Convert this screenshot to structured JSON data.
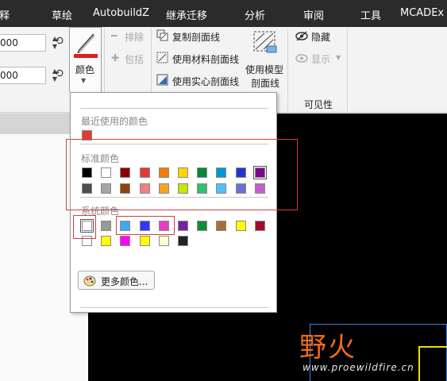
{
  "menu": {
    "items": [
      "注释",
      "草绘",
      "AutobuildZ",
      "继承迁移",
      "分析",
      "审阅",
      "工具",
      "MCADEx"
    ]
  },
  "ribbon": {
    "field1_value": "000",
    "field2_value": "000",
    "color_label": "颜色",
    "exclude_label": "排除",
    "include_label": "包括",
    "copy_hatch_label": "复制剖面线",
    "use_material_hatch_label": "使用材料剖面线",
    "use_solid_hatch_label": "使用实心剖面线",
    "use_model_hatch_label_line1": "使用模型",
    "use_model_hatch_label_line2": "剖面线",
    "hide_label": "隐藏",
    "show_label": "显示",
    "visibility_group_label": "可见性",
    "accent_red": "#e02020"
  },
  "dropdown": {
    "recent_title": "最近使用的颜色",
    "recent_colors": [
      "#e53935"
    ],
    "standard_title": "标准颜色",
    "standard_row1": [
      "#000000",
      "#ffffff",
      "#8b0000",
      "#e53935",
      "#f57c00",
      "#ffd600",
      "#00893a",
      "#0097d6",
      "#2433d6",
      "#7a0a8c"
    ],
    "standard_row2": [
      "#4d4d4d",
      "#a6a6a6",
      "#8b4513",
      "#f08080",
      "#f5a623",
      "#c6e800",
      "#2ec26a",
      "#4fc3f7",
      "#6a6fd8",
      "#c35fcb"
    ],
    "system_title": "系统颜色",
    "system_row1": [
      "#ffffff",
      "#999999",
      "#3fa9f5",
      "#3333ff",
      "#e83cc8",
      "#7a1fa2",
      "#138a38",
      "#a57035",
      "#ffff00",
      "#a10c2e"
    ],
    "system_row2": [
      "#ffffff",
      "#ffff00",
      "#ff00ff",
      "#ffff00",
      "#ffffd6",
      "#222222"
    ],
    "more_colors_label": "更多颜色..."
  },
  "watermark": {
    "logo_text": "野火",
    "url": "www.proewildfire.cn"
  }
}
